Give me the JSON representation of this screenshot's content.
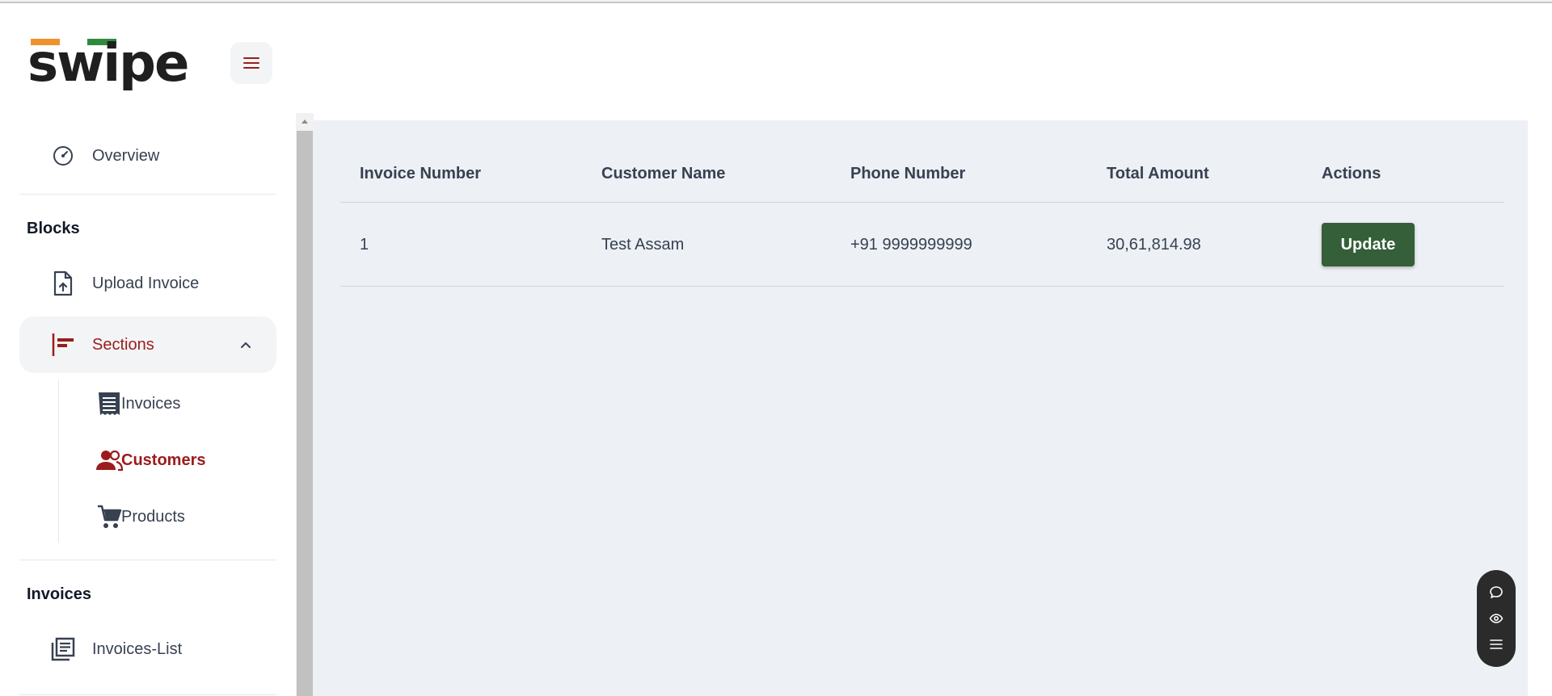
{
  "brand": {
    "logo_text": "swipe",
    "colors": {
      "orange": "#f0922b",
      "green": "#2e8b3e",
      "dark": "#1f1f1f",
      "accent": "#9b1c1c",
      "button": "#355f38"
    }
  },
  "header": {
    "menu_icon": "hamburger-icon"
  },
  "sidebar": {
    "overview": {
      "label": "Overview",
      "icon": "speedometer-icon"
    },
    "blocks_heading": "Blocks",
    "upload_invoice": {
      "label": "Upload Invoice",
      "icon": "file-upload-icon"
    },
    "sections": {
      "label": "Sections",
      "icon": "sections-icon",
      "expanded": true
    },
    "sub_items": [
      {
        "label": "Invoices",
        "icon": "receipt-icon"
      },
      {
        "label": "Customers",
        "icon": "users-icon",
        "current": true
      },
      {
        "label": "Products",
        "icon": "cart-icon"
      }
    ],
    "invoices_heading": "Invoices",
    "invoices_list": {
      "label": "Invoices-List",
      "icon": "list-icon"
    }
  },
  "table": {
    "columns": [
      "Invoice Number",
      "Customer Name",
      "Phone Number",
      "Total Amount",
      "Actions"
    ],
    "rows": [
      {
        "invoice_number": "1",
        "customer_name": "Test Assam",
        "phone_number": "+91 9999999999",
        "total_amount": "30,61,814.98",
        "action_label": "Update"
      }
    ]
  },
  "float_toolbar": [
    "chat-icon",
    "eye-icon",
    "menu-icon"
  ]
}
